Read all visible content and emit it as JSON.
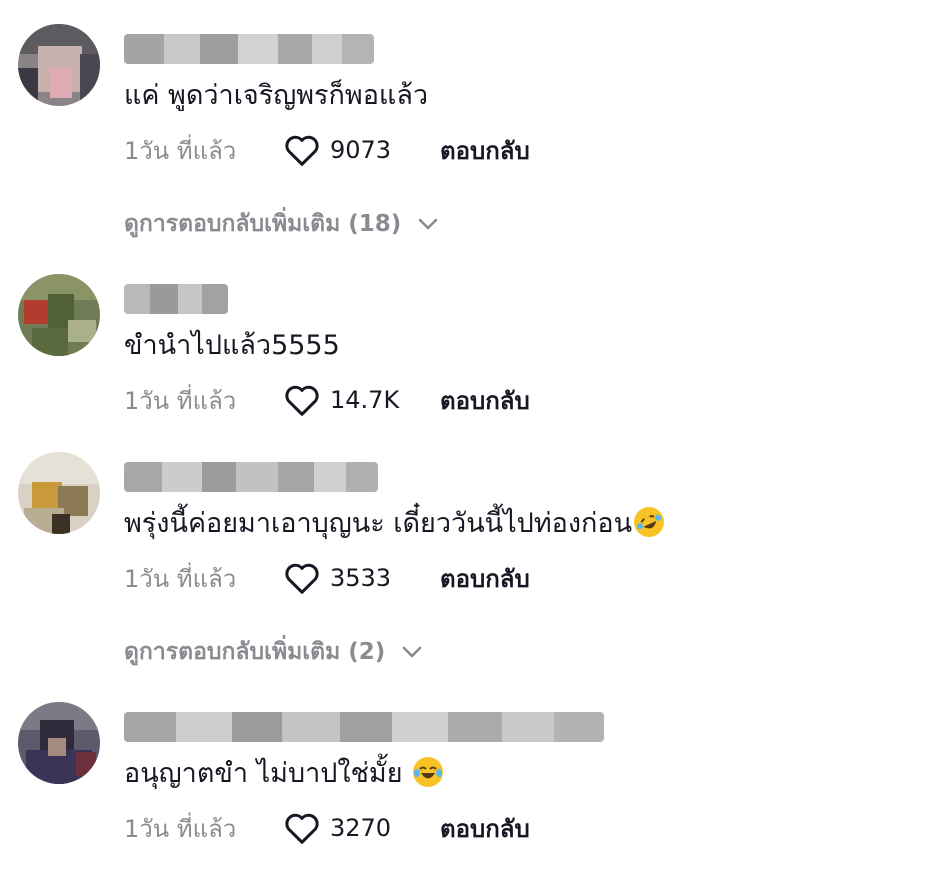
{
  "comments": [
    {
      "username": "Kang Swan@08",
      "text": "แค่ พูดว่าเจริญพรก็พอแล้ว",
      "time": "1วัน ที่แล้ว",
      "likes": "9073",
      "reply_label": "ตอบกลับ",
      "more_replies": "ดูการตอบกลับเพิ่มเติม (18)"
    },
    {
      "username": "ทรายใ",
      "text": "ขำนำไปแล้ว5555",
      "time": "1วัน ที่แล้ว",
      "likes": "14.7K",
      "reply_label": "ตอบกลับ"
    },
    {
      "username": "Lenhtle Catlwa",
      "text": "พรุ่งนี้ค่อยมาเอาบุญนะ เดี๋ยววันนี้ไปท่องก่อน",
      "emoji": "rolling-on-floor-laughing-emoji",
      "time": "1วัน ที่แล้ว",
      "likes": "3533",
      "reply_label": "ตอบกลับ",
      "more_replies": "ดูการตอบกลับเพิ่มเติม (2)"
    },
    {
      "username": "Game_Wilsonanddiea**",
      "text": "อนุญาตขำ ไม่บาปใช่มั้ย",
      "emoji": "tears-of-joy-emoji",
      "time": "1วัน ที่แล้ว",
      "likes": "3270",
      "reply_label": "ตอบกลับ"
    }
  ],
  "colors": {
    "text_primary": "#161823",
    "text_secondary": "#8a8b91",
    "background": "#ffffff"
  }
}
